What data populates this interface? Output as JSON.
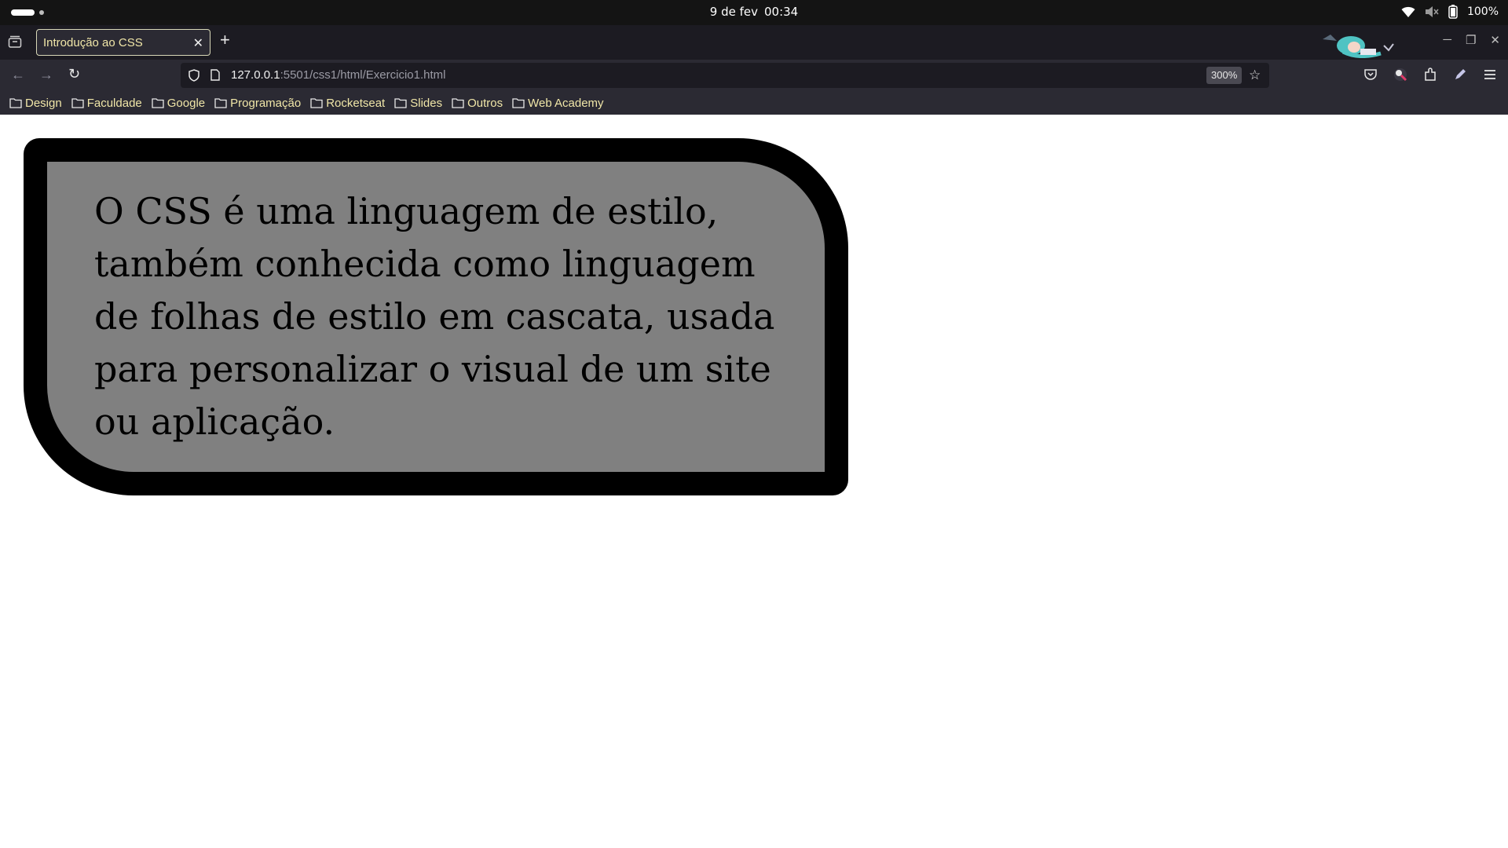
{
  "system_bar": {
    "date": "9 de fev",
    "time": "00:34",
    "battery": "100%"
  },
  "browser": {
    "tab": {
      "title": "Introdução ao CSS"
    },
    "url": {
      "host": "127.0.0.1",
      "rest": ":5501/css1/html/Exercicio1.html"
    },
    "zoom": "300%",
    "bookmarks": [
      {
        "label": "Design"
      },
      {
        "label": "Faculdade"
      },
      {
        "label": "Google"
      },
      {
        "label": "Programação"
      },
      {
        "label": "Rocketseat"
      },
      {
        "label": "Slides"
      },
      {
        "label": "Outros"
      },
      {
        "label": "Web Academy"
      }
    ],
    "icons": [
      "back-icon",
      "forward-icon",
      "reload-icon",
      "shield-icon",
      "page-icon",
      "star-icon",
      "pocket-icon",
      "account-icon",
      "extensions-icon",
      "pen-icon",
      "menu-icon",
      "folder-icon"
    ]
  },
  "page": {
    "paragraph": "O CSS é uma linguagem de estilo, também conhecida como linguagem de folhas de estilo em cascata, usada para personalizar o visual de um site ou aplicação.",
    "box_background": "#808080",
    "box_border": "#000000"
  },
  "colors": {
    "chrome_dark": "#1c1b22",
    "chrome": "#2b2a33",
    "bookmark_text": "#f0e6a8"
  }
}
